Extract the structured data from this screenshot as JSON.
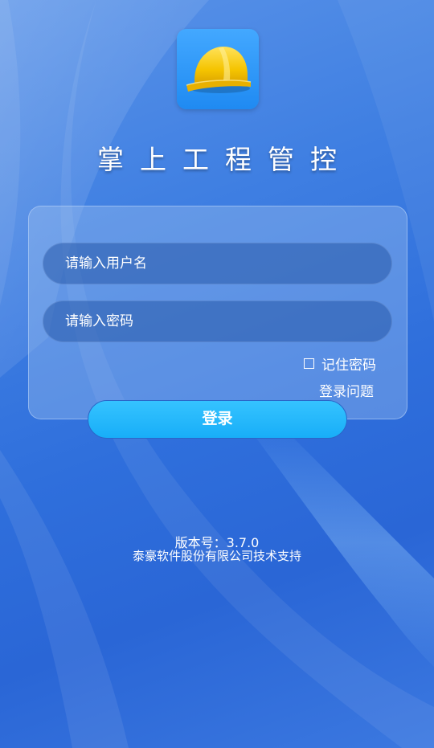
{
  "app": {
    "title": "掌上工程管控",
    "icon": "hard-hat-icon"
  },
  "form": {
    "username_placeholder": "请输入用户名",
    "username_value": "",
    "password_placeholder": "请输入密码",
    "password_value": "",
    "remember_label": "记住密码",
    "remember_checked": false,
    "login_problem_label": "登录问题",
    "login_button_label": "登录"
  },
  "footer": {
    "version": "版本号：3.7.0",
    "support": "泰豪软件股份有限公司技术支持"
  },
  "colors": {
    "background": "#3f7fe2",
    "button": "#1fb4fa",
    "icon_bg": "#2a93f5",
    "helmet": "#f5c400"
  }
}
